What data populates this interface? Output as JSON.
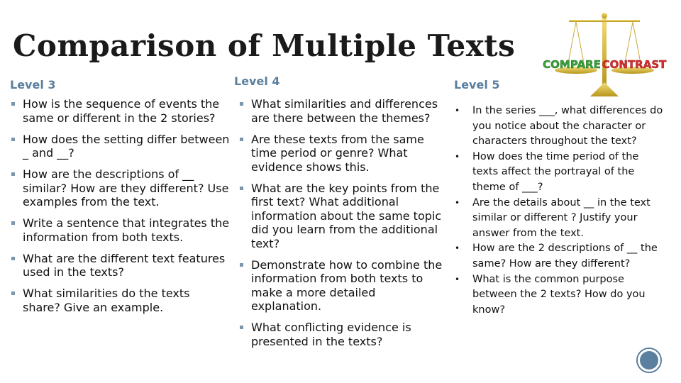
{
  "title": "Comparison of Multiple Texts",
  "image": {
    "icon": "compare-contrast-scale-icon",
    "left_label": "COMPARE",
    "right_label": "CONTRAST",
    "left_color": "#3aa33a",
    "right_color": "#d93030"
  },
  "colors": {
    "heading": "#5b7f9e",
    "bullet": "#7b95ab",
    "text": "#111111"
  },
  "levels": [
    {
      "heading": "Level 3",
      "items": [
        "How is the sequence of events the same or different in the 2 stories?",
        "How does the setting differ between _ and __?",
        "How are the descriptions of __ similar? How are they different? Use examples from the text.",
        "Write a sentence that integrates the information from both texts.",
        "What are the different text features used in the texts?",
        "What similarities do the texts share? Give an example."
      ]
    },
    {
      "heading": "Level 4",
      "items": [
        "What similarities and differences are there between the themes?",
        "Are these texts from the same time period or genre? What evidence shows this.",
        "What are the key points from the first text? What additional information about the same topic did you learn from the additional text?",
        "Demonstrate how to combine the information from both texts to make a more detailed explanation.",
        "What conflicting evidence is presented in the texts?"
      ]
    },
    {
      "heading": "Level 5",
      "items": [
        "In the series ___, what differences do you notice about the character or characters throughout the text?",
        "How does the time period of the texts affect the  portrayal of the theme of ___?",
        "Are the details about __ in the text similar or different ? Justify your answer from the text.",
        "How are the 2 descriptions of __ the same? How are they different?",
        "What is the common purpose between the 2 texts? How do you know?"
      ]
    }
  ]
}
